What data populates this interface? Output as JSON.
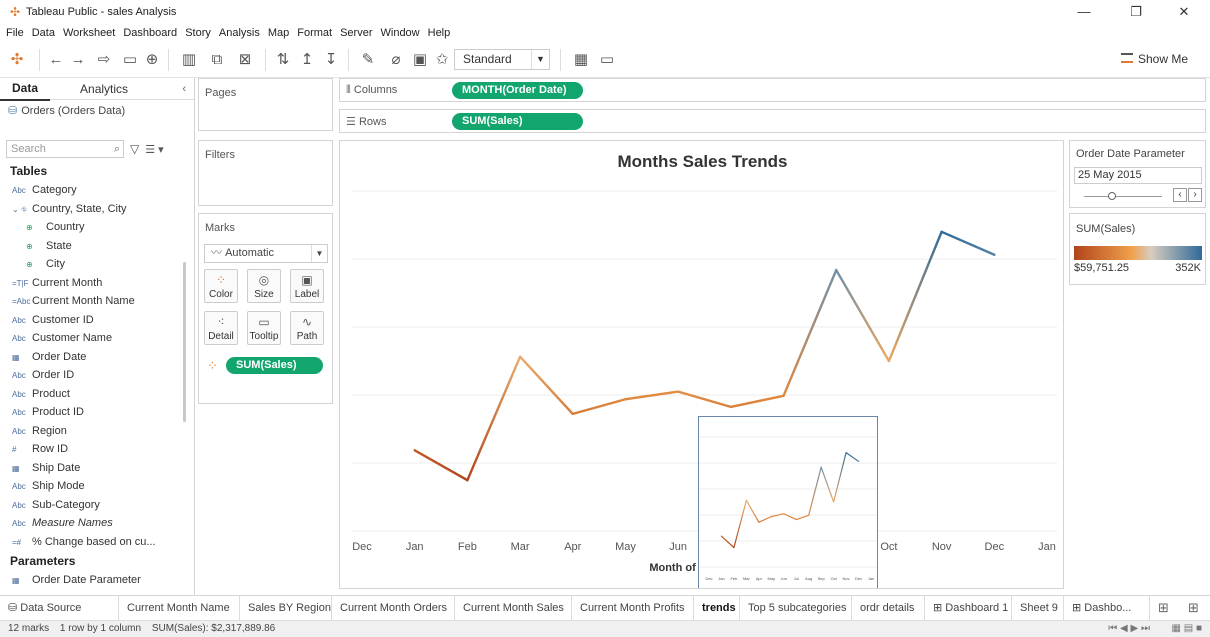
{
  "window": {
    "title": "Tableau Public - sales Analysis",
    "minimize_glyph": "—",
    "maximize_glyph": "❐",
    "close_glyph": "✕"
  },
  "menu": [
    "File",
    "Data",
    "Worksheet",
    "Dashboard",
    "Story",
    "Analysis",
    "Map",
    "Format",
    "Server",
    "Window",
    "Help"
  ],
  "toolbar": {
    "fit_value": "Standard",
    "show_me_label": "Show Me"
  },
  "data_pane": {
    "tabs": [
      "Data",
      "Analytics"
    ],
    "source": "Orders (Orders Data)",
    "search_placeholder": "Search",
    "tables_heading": "Tables",
    "fields": [
      {
        "type": "Abc",
        "name": "Category",
        "indent": false,
        "italic": false
      },
      {
        "type": "⌄ ⛗",
        "name": "Country, State, City",
        "indent": false,
        "italic": false
      },
      {
        "type": "⊕",
        "name": "Country",
        "indent": true,
        "italic": false
      },
      {
        "type": "⊕",
        "name": "State",
        "indent": true,
        "italic": false
      },
      {
        "type": "⊕",
        "name": "City",
        "indent": true,
        "italic": false
      },
      {
        "type": "=T|F",
        "name": "Current Month",
        "indent": false,
        "italic": false
      },
      {
        "type": "=Abc",
        "name": "Current Month Name",
        "indent": false,
        "italic": false
      },
      {
        "type": "Abc",
        "name": "Customer ID",
        "indent": false,
        "italic": false
      },
      {
        "type": "Abc",
        "name": "Customer Name",
        "indent": false,
        "italic": false
      },
      {
        "type": "▦",
        "name": "Order Date",
        "indent": false,
        "italic": false
      },
      {
        "type": "Abc",
        "name": "Order ID",
        "indent": false,
        "italic": false
      },
      {
        "type": "Abc",
        "name": "Product",
        "indent": false,
        "italic": false
      },
      {
        "type": "Abc",
        "name": "Product ID",
        "indent": false,
        "italic": false
      },
      {
        "type": "Abc",
        "name": "Region",
        "indent": false,
        "italic": false
      },
      {
        "type": "#",
        "name": "Row ID",
        "indent": false,
        "italic": false
      },
      {
        "type": "▦",
        "name": "Ship Date",
        "indent": false,
        "italic": false
      },
      {
        "type": "Abc",
        "name": "Ship Mode",
        "indent": false,
        "italic": false
      },
      {
        "type": "Abc",
        "name": "Sub-Category",
        "indent": false,
        "italic": false
      },
      {
        "type": "Abc",
        "name": "Measure Names",
        "indent": false,
        "italic": true
      },
      {
        "type": "=#",
        "name": "% Change based on cu...",
        "indent": false,
        "italic": false
      }
    ],
    "parameters_heading": "Parameters",
    "parameters": [
      {
        "type": "▦",
        "name": "Order Date Parameter"
      }
    ]
  },
  "pages_label": "Pages",
  "filters_label": "Filters",
  "marks": {
    "label": "Marks",
    "mark_type": "Automatic",
    "buttons": [
      "Color",
      "Size",
      "Label",
      "Detail",
      "Tooltip",
      "Path"
    ],
    "pill": "SUM(Sales)"
  },
  "columns": {
    "label": "Columns",
    "pill": "MONTH(Order Date)"
  },
  "rows": {
    "label": "Rows",
    "pill": "SUM(Sales)"
  },
  "chart_data": {
    "type": "line",
    "title": "Months Sales Trends",
    "xlabel": "Month of Order Date",
    "tick_labels": [
      "Dec",
      "Jan",
      "Feb",
      "Mar",
      "Apr",
      "May",
      "Jun",
      "Jul",
      "Aug",
      "Sep",
      "Oct",
      "Nov",
      "Dec",
      "Jan"
    ],
    "categories": [
      "Jan",
      "Feb",
      "Mar",
      "Apr",
      "May",
      "Jun",
      "Jul",
      "Aug",
      "Sep",
      "Oct",
      "Nov",
      "Dec"
    ],
    "values": [
      94925,
      59751.25,
      205005,
      137762,
      155000,
      164000,
      146000,
      159000,
      307000,
      200000,
      352000,
      325000
    ],
    "ylim": [
      0,
      400000
    ],
    "grid": true,
    "color_low": "#b0441c",
    "color_mid": "#f0a04b",
    "color_high": "#2f6a98"
  },
  "param_card": {
    "title": "Order Date Parameter",
    "value": "25 May 2015"
  },
  "legend": {
    "title": "SUM(Sales)",
    "min_label": "$59,751.25",
    "max_label": "352K"
  },
  "sheet_tabs": [
    "Data Source",
    "Current Month Name",
    "Sales BY Region",
    "Current Month Orders",
    "Current Month Sales",
    "Current Month Profits",
    "trends",
    "Top 5 subcategories",
    "ordr details",
    "Dashboard 1",
    "Sheet 9",
    "Dashbo..."
  ],
  "active_tab": "trends",
  "status": {
    "marks": "12 marks",
    "dims": "1 row by 1 column",
    "sum": "SUM(Sales): $2,317,889.86"
  }
}
